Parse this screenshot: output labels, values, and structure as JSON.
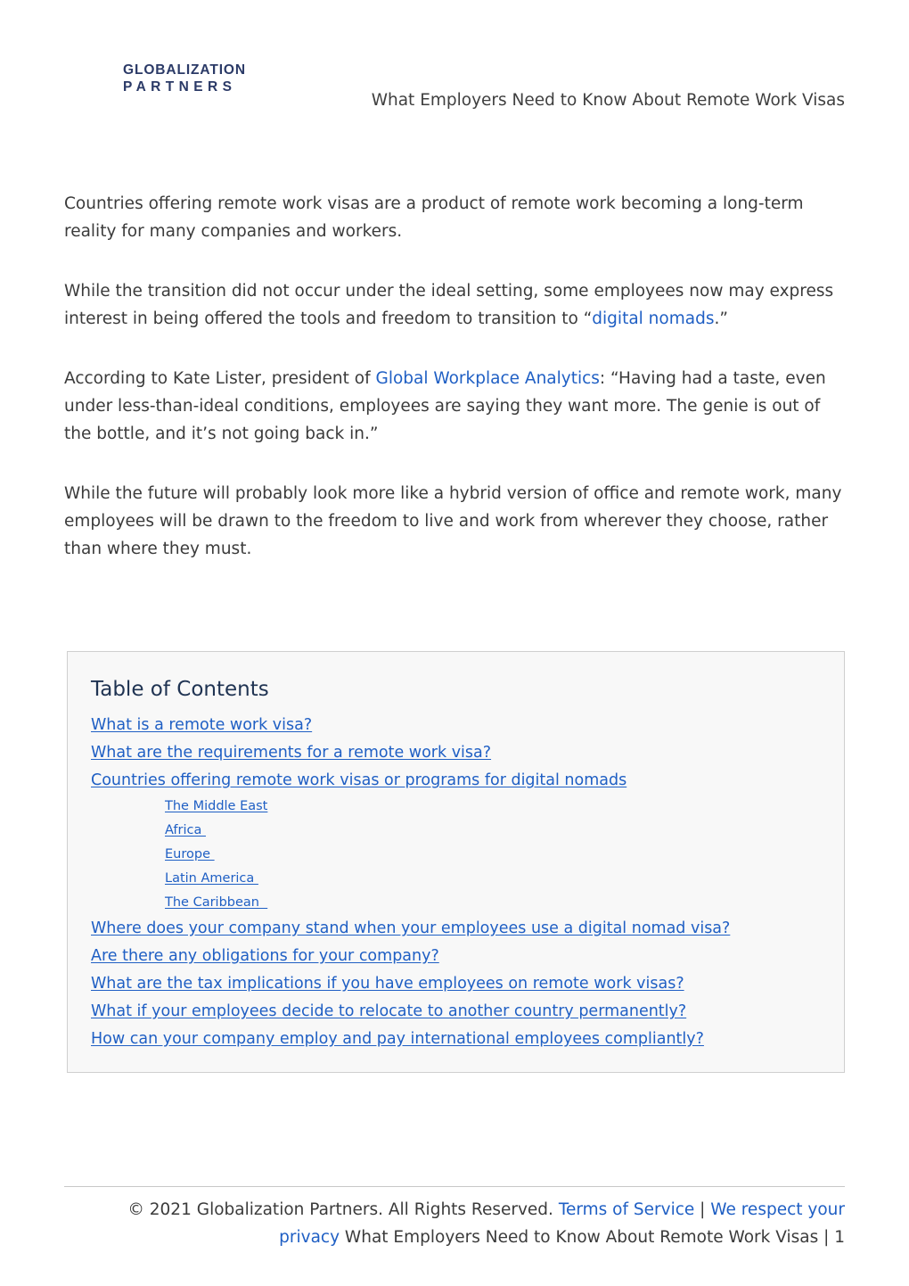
{
  "header": {
    "logo_icon": "globalization-partners-ring-logo",
    "logo_line1": "GLOBALIZATION",
    "logo_line2": "PARTNERS",
    "title": "What Employers Need to Know About Remote Work Visas"
  },
  "colors": {
    "link_blue": "#1f5fc4",
    "heading_navy": "#1f3352",
    "logo_navy": "#2b3a67",
    "logo_cyan": "#00b5e8",
    "logo_blue": "#0f7fd4",
    "body_text": "#3b3b3b",
    "toc_background": "#f8f8f8",
    "toc_border": "#cfcfcf"
  },
  "body": {
    "p1": "Countries offering remote work visas are a product of remote work becoming a long-term reality for many companies and workers.",
    "p2_before": "While the transition did not occur under the ideal setting, some employees now may express interest in being offered the tools and freedom to transition to “",
    "p2_link": "digital nomads",
    "p2_after": ".”",
    "p3_before": "According to Kate Lister, president of ",
    "p3_link": "Global Workplace Analytics",
    "p3_after": ": “Having had a taste, even under less-than-ideal conditions, employees are saying they want more. The genie is out of the bottle, and it’s not going back in.”",
    "p4": "While the future will probably look more like a hybrid version of office and remote work, many employees will be drawn to the freedom to live and work from wherever they choose, rather than where they must."
  },
  "toc": {
    "title": "Table of Contents",
    "items": [
      {
        "label": "What is a remote work visa?",
        "level": 1
      },
      {
        "label": "What are the requirements for a remote work visa?",
        "level": 1
      },
      {
        "label": "Countries offering remote work visas or programs for digital nomads",
        "level": 1
      },
      {
        "label": "The Middle East",
        "level": 2
      },
      {
        "label": "Africa ",
        "level": 2
      },
      {
        "label": "Europe ",
        "level": 2
      },
      {
        "label": "Latin America ",
        "level": 2
      },
      {
        "label": "The Caribbean  ",
        "level": 2
      },
      {
        "label": "Where does your company stand when your employees use a digital nomad visa?",
        "level": 1
      },
      {
        "label": "Are there any obligations for your company?",
        "level": 1
      },
      {
        "label": "What are the tax implications if you have employees on remote work visas?",
        "level": 1
      },
      {
        "label": "What if your employees decide to relocate to another country permanently?",
        "level": 1
      },
      {
        "label": "How can your company employ and pay international employees compliantly?",
        "level": 1
      }
    ]
  },
  "footer": {
    "copyright": "© 2021 Globalization Partners. All Rights Reserved. ",
    "terms_link": "Terms of Service",
    "separator": " | ",
    "privacy_link": "We respect your privacy",
    "doc_title": " What Employers Need to Know About Remote Work Visas | ",
    "page_number": "1"
  }
}
